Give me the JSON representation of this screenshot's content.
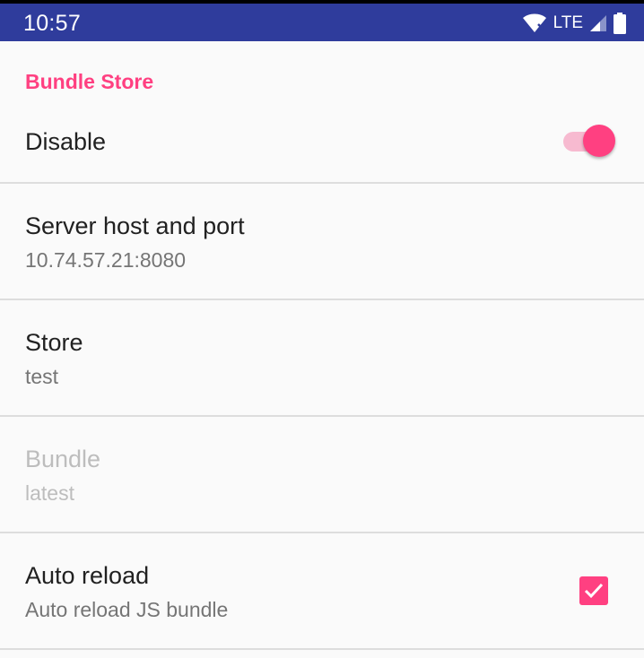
{
  "status_bar": {
    "time": "10:57",
    "network": "LTE",
    "icons": [
      "wifi-icon",
      "signal-icon",
      "battery-icon"
    ],
    "background_color": "#2f3c9c"
  },
  "category": {
    "title": "Bundle Store",
    "accent_color": "#ff4081"
  },
  "switch_pref": {
    "label": "Disable",
    "checked": true
  },
  "preferences": [
    {
      "title": "Server host and port",
      "summary": "10.74.57.21:8080",
      "enabled": true
    },
    {
      "title": "Store",
      "summary": "test",
      "enabled": true
    },
    {
      "title": "Bundle",
      "summary": "latest",
      "enabled": false
    },
    {
      "title": "Auto reload",
      "summary": "Auto reload JS bundle",
      "enabled": true,
      "checked": true
    }
  ]
}
